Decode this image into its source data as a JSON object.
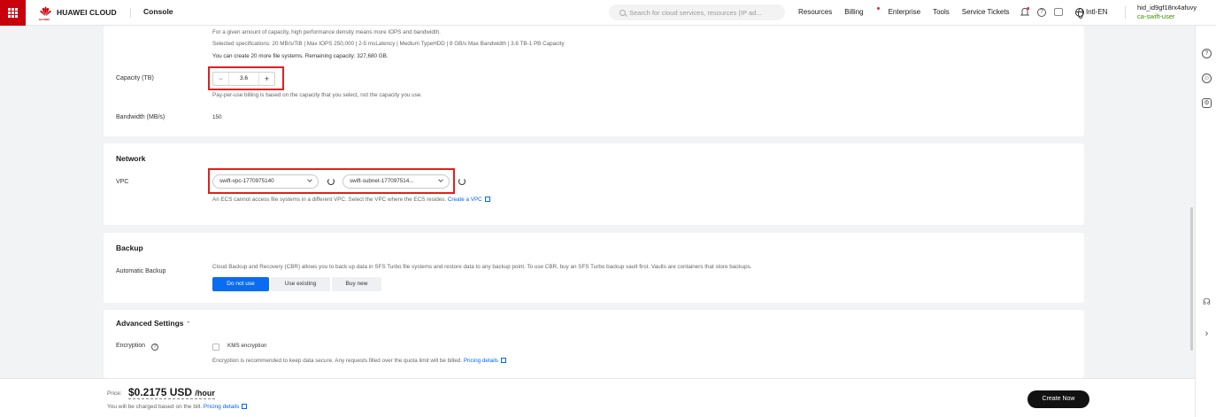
{
  "topbar": {
    "brand_name": "HUAWEI CLOUD",
    "brand_sub": "HUAWEI",
    "console": "Console",
    "search_placeholder": "Search for cloud services, resources (IP ad...",
    "links": [
      "Resources",
      "Billing",
      "Enterprise",
      "Tools",
      "Service Tickets"
    ],
    "region": "Intl-EN",
    "user_name": "hid_id9gf18rx4afuvy",
    "user_sub": "ca-swift-user"
  },
  "capacity_card": {
    "line1": "For a given amount of capacity, high performance density means more IOPS and bandwidth.",
    "line2": "Selected specifications: 20 MB/s/TiB | Max IOPS 250,000 | 2-5 msLatency | Medium TypeHDD | 8 GB/s Max Bandwidth | 3.6 TB-1 PB Capacity",
    "line3": "You can create 20 more file systems. Remaining capacity: 327,680 GB.",
    "capacity_label": "Capacity (TB)",
    "capacity_value": "3.6",
    "capacity_hint": "Pay-per-use billing is based on the capacity that you select, not the capacity you use.",
    "bandwidth_label": "Bandwidth (MB/s)",
    "bandwidth_value": "150"
  },
  "network": {
    "title": "Network",
    "vpc_label": "VPC",
    "vpc_value": "swift-vpc-1770975140",
    "subnet_value": "swift-subnet-177097514...",
    "hint": "An ECS cannot access file systems in a different VPC. Select the VPC where the ECS resides.",
    "create_vpc": "Create a VPC"
  },
  "backup": {
    "title": "Backup",
    "label": "Automatic Backup",
    "description": "Cloud Backup and Recovery (CBR) allows you to back up data in SFS Turbo file systems and restore data to any backup point. To use CBR, buy an SFS Turbo backup vault first. Vaults are containers that store backups.",
    "options": [
      "Do not use",
      "Use existing",
      "Buy new"
    ]
  },
  "advanced": {
    "title": "Advanced Settings",
    "encryption_label": "Encryption",
    "kms_label": "KMS encryption",
    "hint": "Encryption is recommended to keep data secure. Any requests filled over the quota limit will be billed.",
    "pricing_link": "Pricing details"
  },
  "footer": {
    "price_label": "Price:",
    "price_value": "$0.2175 USD",
    "price_unit": "/hour",
    "note": "You will be charged based on the bill.",
    "pricing_link": "Pricing details",
    "create_button": "Create Now"
  },
  "colors": {
    "brand": "#c7000b",
    "primary": "#0a6cf0",
    "highlight": "#e02020"
  }
}
